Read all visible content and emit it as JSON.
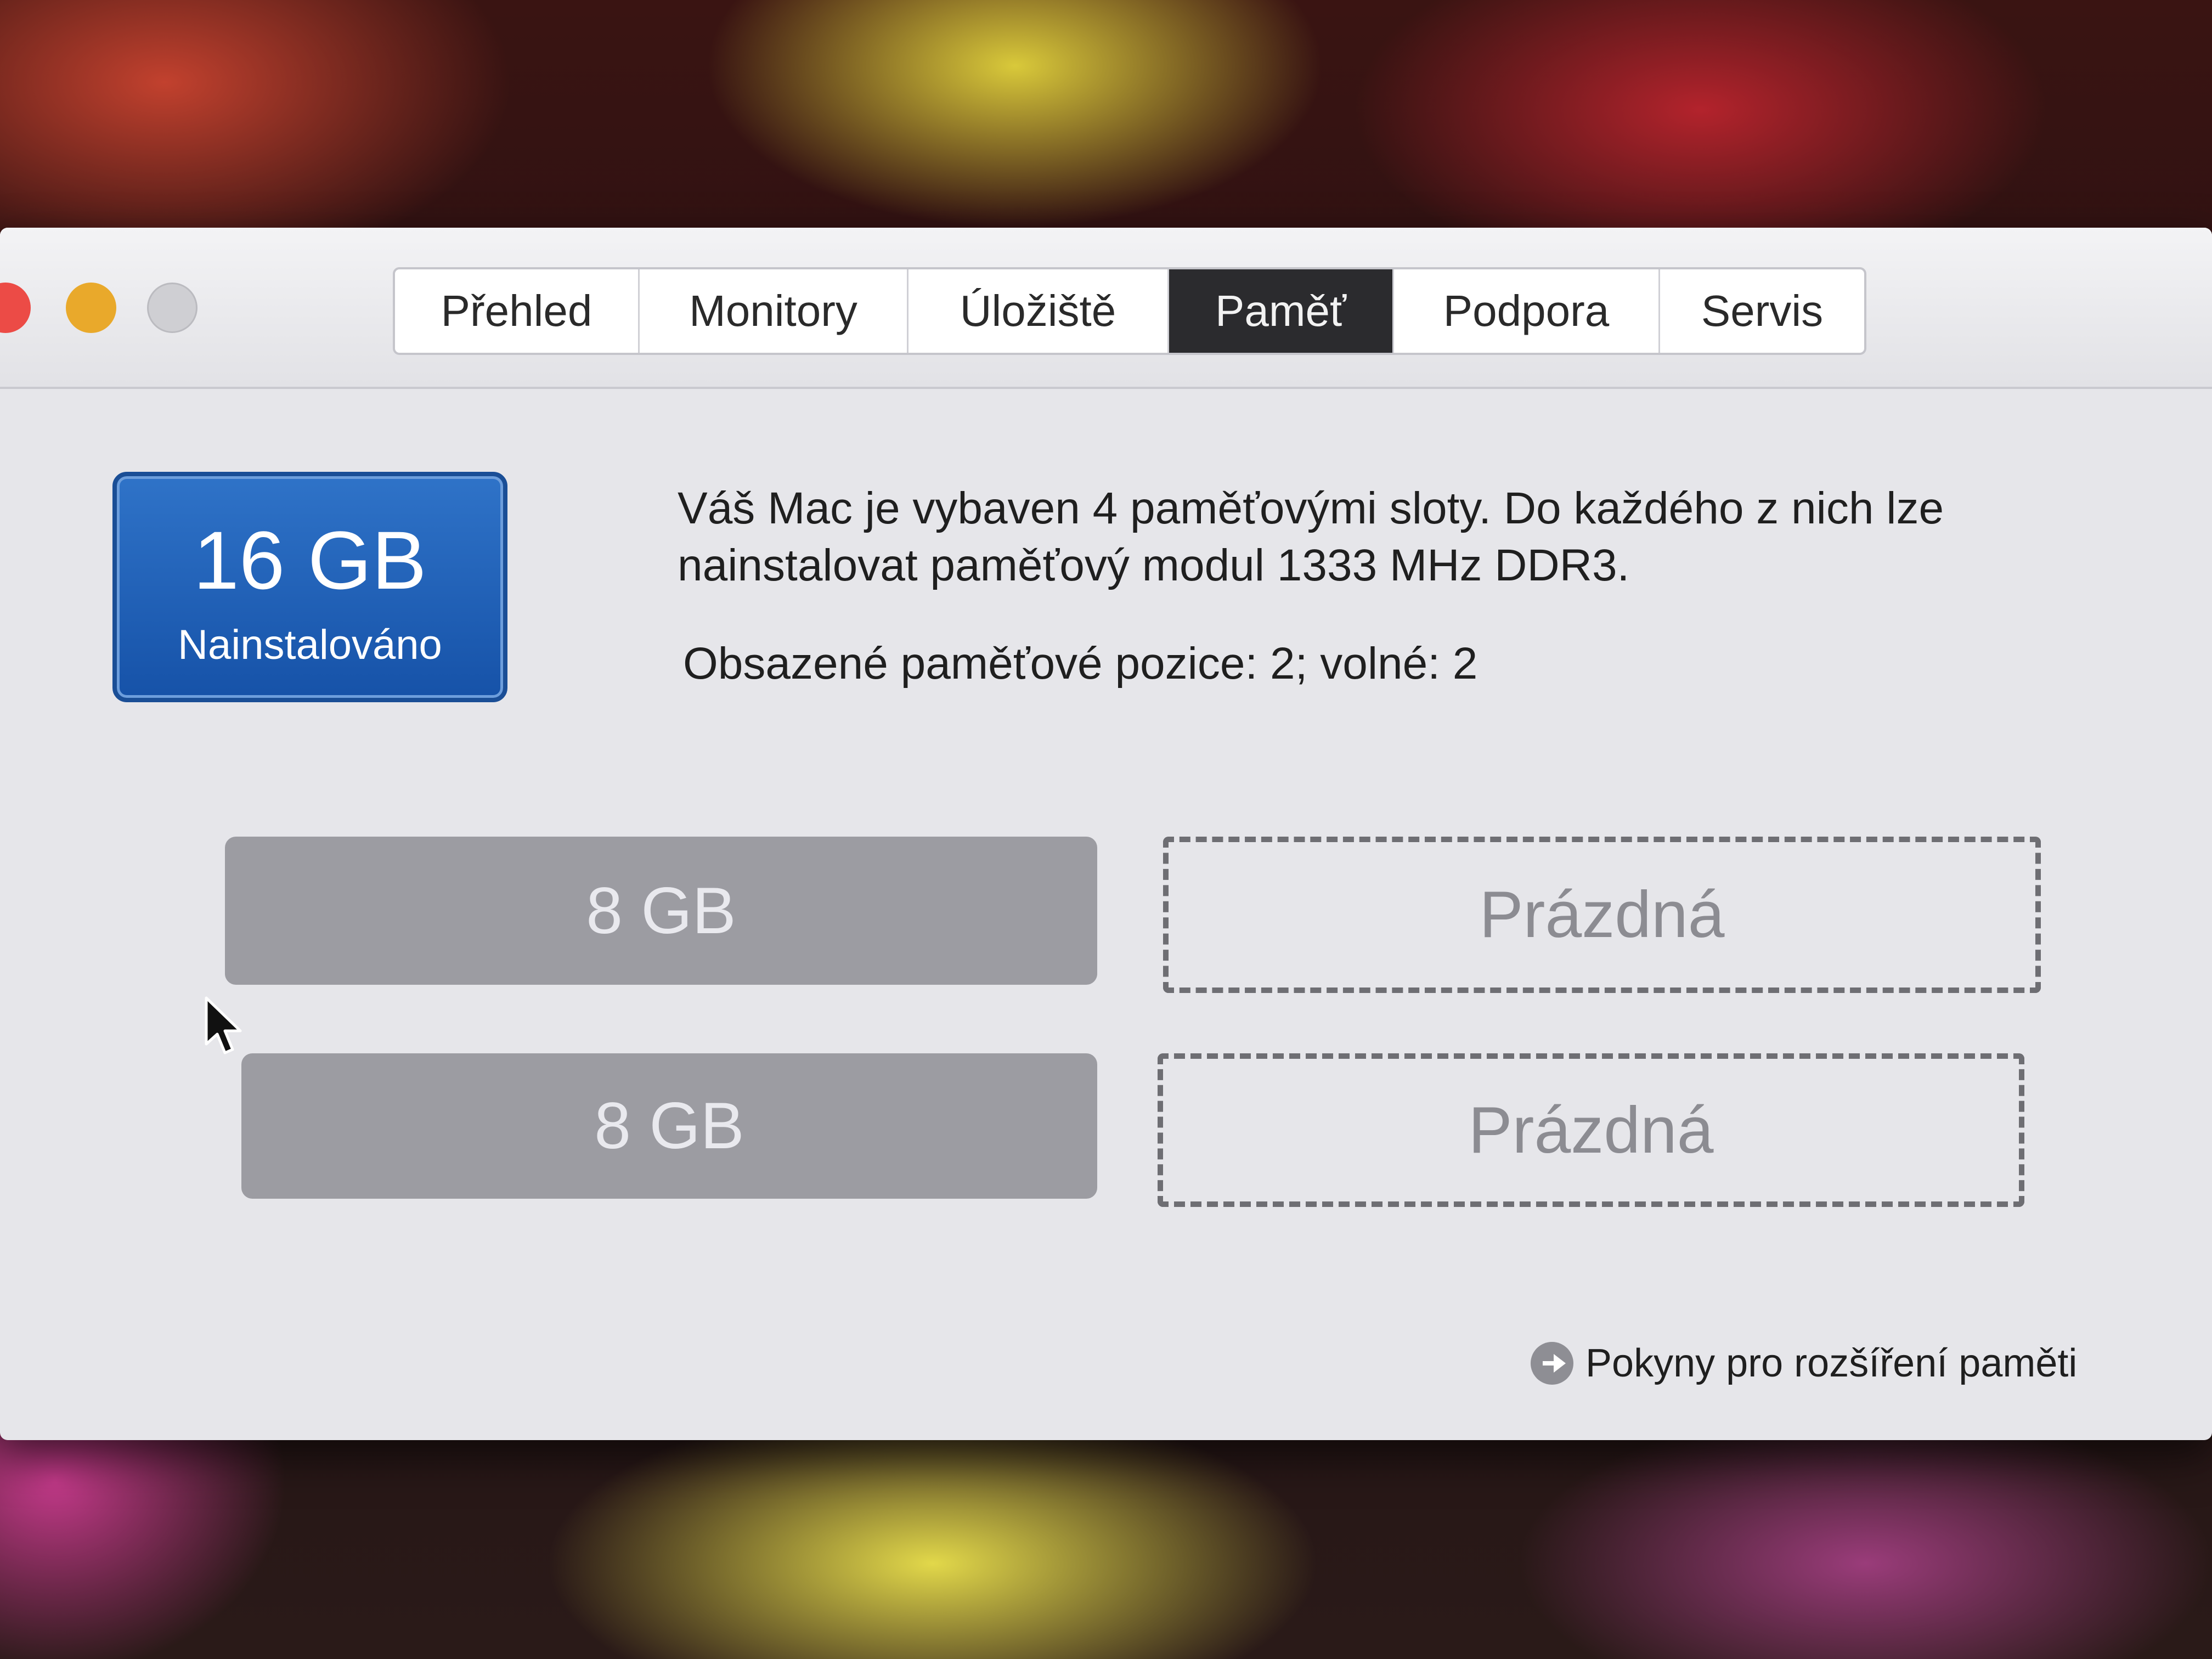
{
  "window": {
    "tabs": [
      {
        "label": "Přehled",
        "selected": false
      },
      {
        "label": "Monitory",
        "selected": false
      },
      {
        "label": "Úložiště",
        "selected": false
      },
      {
        "label": "Paměť",
        "selected": true
      },
      {
        "label": "Podpora",
        "selected": false
      },
      {
        "label": "Servis",
        "selected": false
      }
    ]
  },
  "memory": {
    "installed_size": "16 GB",
    "installed_label": "Nainstalováno",
    "description": "Váš Mac je vybaven 4 paměťovými sloty. Do každého z nich lze nainstalovat paměťový modul 1333 MHz DDR3.",
    "slot_status": "Obsazené paměťové pozice: 2; volné: 2",
    "slots": [
      {
        "label": "8 GB",
        "state": "filled"
      },
      {
        "label": "Prázdná",
        "state": "empty"
      },
      {
        "label": "8 GB",
        "state": "filled"
      },
      {
        "label": "Prázdná",
        "state": "empty"
      }
    ],
    "upgrade_link": "Pokyny pro rozšíření paměti"
  },
  "colors": {
    "badge_blue": "#1e5fb5",
    "selected_tab": "#2b2b2e",
    "filled_slot": "#9c9ca2"
  },
  "icons": [
    "arrow-right-circle-icon",
    "mouse-pointer-icon"
  ]
}
